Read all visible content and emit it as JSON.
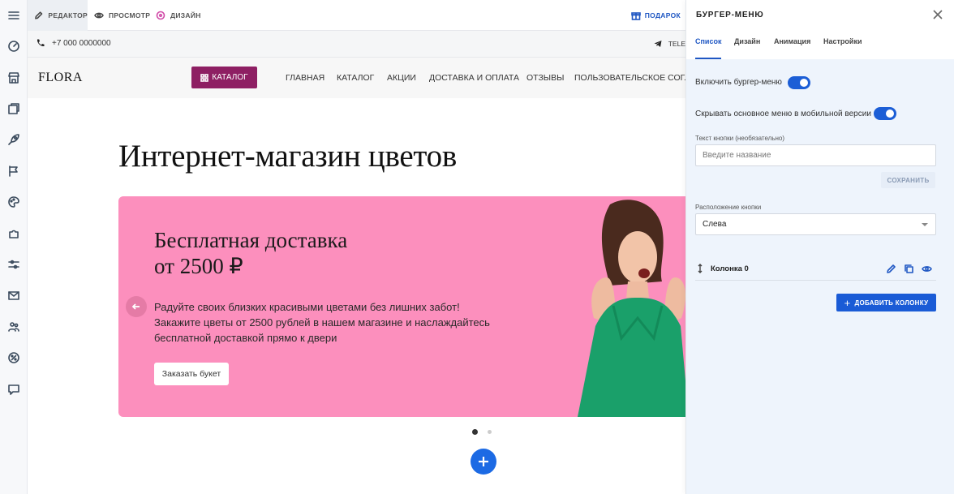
{
  "toolbar": {
    "modes": [
      {
        "label": "РЕДАКТОР",
        "icon": "pencil-icon",
        "active": true
      },
      {
        "label": "ПРОСМОТР",
        "icon": "eye-icon",
        "active": false
      },
      {
        "label": "ДИЗАЙН",
        "icon": "palette-icon",
        "active": false
      }
    ],
    "gift_label": "ПОДАРОК"
  },
  "sidebar": {
    "icons": [
      "menu-icon",
      "dashboard-icon",
      "store-icon",
      "pages-icon",
      "rocket-icon",
      "flag-icon",
      "palette-icon",
      "puzzle-icon",
      "sliders-icon",
      "mail-icon",
      "users-icon",
      "percent-icon",
      "chat-icon"
    ]
  },
  "site": {
    "phone": "+7 000 0000000",
    "telegram_label": "TELE",
    "logo": "FLORA",
    "catalog_button": "КАТАЛОГ",
    "nav": [
      "ГЛАВНАЯ",
      "КАТАЛОГ",
      "АКЦИИ",
      "ДОСТАВКА И ОПЛАТА",
      "ОТЗЫВЫ",
      "ПОЛЬЗОВАТЕЛЬСКОЕ СОГЛА"
    ],
    "heading": "Интернет-магазин цветов",
    "banner": {
      "title_line1": "Бесплатная доставка",
      "title_line2": "от 2500 ₽",
      "text": "Радуйте своих близких красивыми цветами без лишних забот! Закажите цветы от 2500 рублей в нашем магазине и наслаждайтесь бесплатной доставкой прямо к двери",
      "button": "Заказать букет",
      "bg_color": "#fc8fbd"
    }
  },
  "panel": {
    "title": "БУРГЕР-МЕНЮ",
    "tabs": [
      {
        "label": "Список",
        "active": true
      },
      {
        "label": "Дизайн",
        "active": false
      },
      {
        "label": "Анимация",
        "active": false
      },
      {
        "label": "Настройки",
        "active": false
      }
    ],
    "toggle_burger_label": "Включить бургер-меню",
    "toggle_hide_label": "Скрывать основное меню в мобильной версии",
    "button_text_label": "Текст кнопки (необязательно)",
    "button_text_placeholder": "Введите название",
    "save_button": "СОХРАНИТЬ",
    "position_label": "Расположение кнопки",
    "position_value": "Слева",
    "column_name": "Колонка 0",
    "add_column_button": "ДОБАВИТЬ КОЛОНКУ",
    "accent_color": "#1c5ed6"
  }
}
